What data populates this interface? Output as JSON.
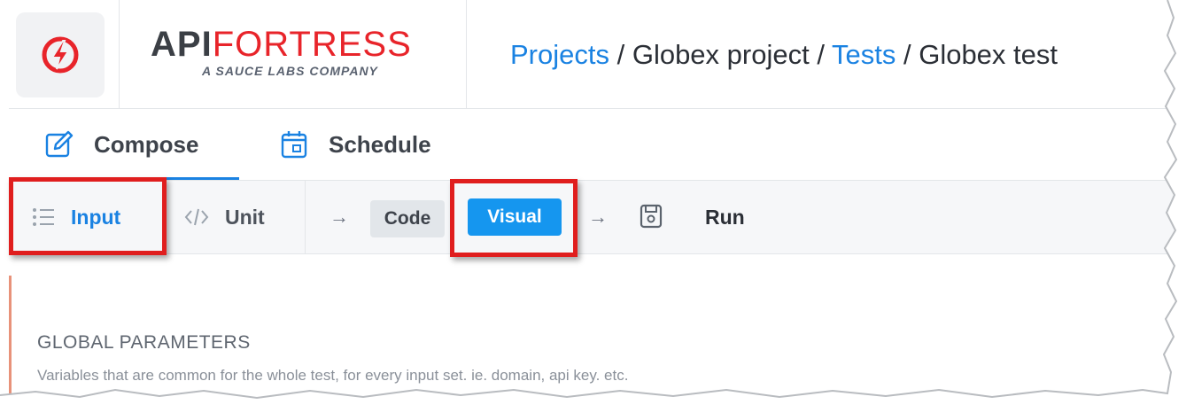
{
  "header": {
    "logo_icon": "bolt-logo-icon",
    "brand": {
      "name_bold": "API",
      "name_light": "FORTRESS",
      "tagline": "A SAUCE LABS COMPANY"
    },
    "breadcrumb": {
      "projects": "Projects",
      "sep1": " / ",
      "project": "Globex project",
      "sep2": " / ",
      "tests": "Tests",
      "sep3": " / ",
      "test": "Globex test"
    }
  },
  "tabs": [
    {
      "label": "Compose",
      "icon": "edit-icon",
      "active": true
    },
    {
      "label": "Schedule",
      "icon": "calendar-icon",
      "active": false
    }
  ],
  "toolbar": {
    "input_label": "Input",
    "input_icon": "list-icon",
    "unit_label": "Unit",
    "unit_icon": "code-icon",
    "arrow": "→",
    "code_label": "Code",
    "visual_label": "Visual",
    "save_icon": "save-icon",
    "run_label": "Run"
  },
  "content": {
    "section_title": "GLOBAL PARAMETERS",
    "section_desc": "Variables that are common for the whole test, for every input set. ie. domain, api key. etc."
  },
  "colors": {
    "accent": "#1a82e2",
    "visual_button": "#1596ef",
    "brand_red": "#e8242a",
    "highlight": "#e01e1e"
  }
}
